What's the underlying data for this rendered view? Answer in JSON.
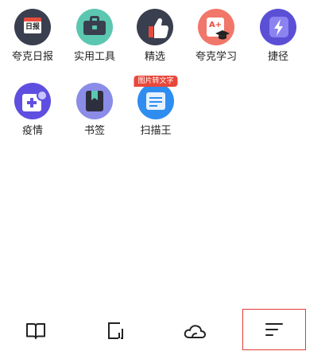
{
  "apps": [
    {
      "label": "夸克日报",
      "icon": "daily-news-icon",
      "icon_text": "日报",
      "bg": "#3a3f4f"
    },
    {
      "label": "实用工具",
      "icon": "toolbox-icon",
      "bg": "#5cc7b0"
    },
    {
      "label": "精选",
      "icon": "thumbs-up-icon",
      "bg": "#3a3f4f"
    },
    {
      "label": "夸克学习",
      "icon": "learning-cap-icon",
      "icon_text": "A+",
      "bg": "#f0776a"
    },
    {
      "label": "捷径",
      "icon": "shortcut-lightning-icon",
      "bg": "#5b4fd6"
    },
    {
      "label": "疫情",
      "icon": "health-cross-icon",
      "bg": "#5f4fe0"
    },
    {
      "label": "书签",
      "icon": "bookmark-icon",
      "bg": "#8a8ce8"
    },
    {
      "label": "扫描王",
      "icon": "scan-document-icon",
      "bg": "#2f8df0",
      "badge": "图片转文字"
    }
  ],
  "bottom_nav": [
    {
      "name": "bookmarks-book",
      "icon": "open-book-icon"
    },
    {
      "name": "tabs-window",
      "icon": "window-tab-icon"
    },
    {
      "name": "cloud",
      "icon": "cloud-icon"
    },
    {
      "name": "menu",
      "icon": "menu-lines-icon",
      "selected": true
    }
  ],
  "colors": {
    "selection_outline": "#e53935",
    "label_text": "#222222"
  }
}
